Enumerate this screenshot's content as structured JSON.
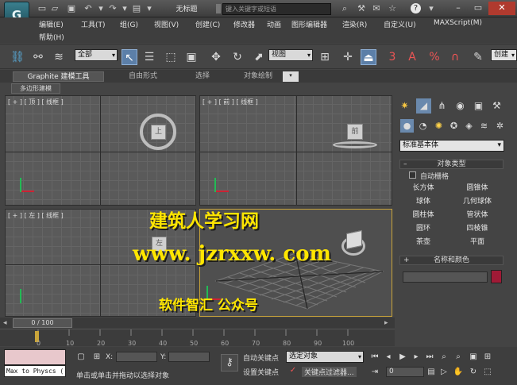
{
  "window": {
    "title": "无标题",
    "search_placeholder": "键入关键字或短语"
  },
  "menu": {
    "row1": [
      "编辑(E)",
      "工具(T)",
      "组(G)",
      "视图(V)",
      "创建(C)",
      "修改器",
      "动画",
      "图形编辑器",
      "渲染(R)",
      "自定义(U)",
      "MAXScript(M)"
    ],
    "row2": [
      "帮助(H)"
    ]
  },
  "toolbar": {
    "selection_filter": "全部",
    "reference_coord": "视图",
    "snap_3d_label": "3",
    "snap_angle_label": "A",
    "snap_percent_label": "%",
    "named_sel_field": "创建"
  },
  "ribbon": {
    "tabs": [
      "Graphite 建模工具",
      "自由形式",
      "选择",
      "对象绘制"
    ],
    "subtab": "多边形建模"
  },
  "viewports": [
    {
      "label": "[ + ] [ 顶 ] [ 线框 ]",
      "cube_text": "上"
    },
    {
      "label": "[ + ] [ 前 ] [ 线框 ]",
      "cube_text": "前"
    },
    {
      "label": "[ + ] [ 左 ] [ 线框 ]",
      "cube_text": "左"
    },
    {
      "label": ""
    }
  ],
  "command_panel": {
    "category": "标准基本体",
    "object_type_header": "对象类型",
    "auto_grid": "自动栅格",
    "buttons": [
      "长方体",
      "圆锥体",
      "球体",
      "几何球体",
      "圆柱体",
      "管状体",
      "圆环",
      "四棱锥",
      "茶壶",
      "平面"
    ],
    "name_color_header": "名称和颜色",
    "object_color": "#a01a36"
  },
  "timeline": {
    "slider": "0 / 100",
    "ticks": [
      "0",
      "10",
      "20",
      "30",
      "40",
      "50",
      "60",
      "70",
      "80",
      "90",
      "100"
    ]
  },
  "status": {
    "script_field": "Max to Physcs (",
    "x_label": "X:",
    "y_label": "Y:",
    "prompt": "单击或单击并拖动以选择对象",
    "auto_key": "自动关键点",
    "set_key": "设置关键点",
    "selected_dropdown": "选定对象",
    "key_filters": "关键点过滤器...",
    "frame_value": "0"
  },
  "watermark": {
    "line1": "建筑人学习网",
    "line2": "www. jzrxxw. com",
    "line3": "软件智汇 公众号"
  },
  "icons": [
    "app-logo",
    "new-icon",
    "open-icon",
    "save-icon",
    "undo-icon",
    "redo-icon",
    "select-icon",
    "move-icon",
    "rotate-icon",
    "scale-icon",
    "snap-icon",
    "play-icon",
    "key-icon",
    "zoom-icon",
    "pan-icon",
    "orbit-icon",
    "help-icon"
  ]
}
